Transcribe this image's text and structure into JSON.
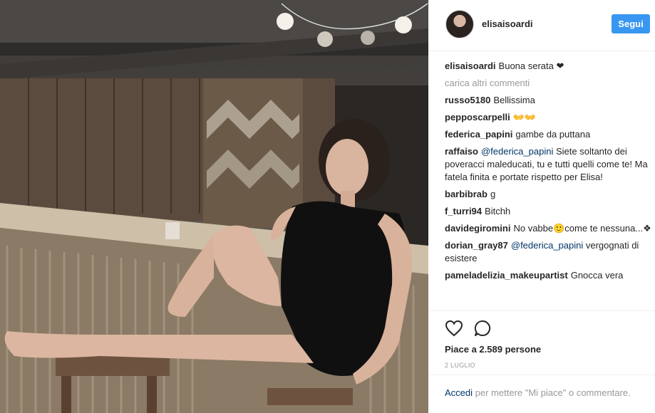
{
  "post": {
    "username": "elisaisoardi",
    "follow_label": "Segui",
    "caption_user": "elisaisoardi",
    "caption_text": "Buona serata ❤",
    "load_more": "carica altri commenti",
    "comments": [
      {
        "user": "russo5180",
        "text": "Bellissima",
        "mention": ""
      },
      {
        "user": "pepposcarpelli",
        "text": "👐👐",
        "mention": ""
      },
      {
        "user": "federica_papini",
        "text": "gambe da puttana",
        "mention": ""
      },
      {
        "user": "raffaiso",
        "mention": "@federica_papini",
        "text": "Siete soltanto dei poveracci maleducati, tu e tutti quelli come te! Ma fatela finita e portate rispetto per Elisa!"
      },
      {
        "user": "barbibrab",
        "text": "g",
        "mention": ""
      },
      {
        "user": "f_turri94",
        "text": "Bitchh",
        "mention": ""
      },
      {
        "user": "davidegiromini",
        "text": "No vabbe🙂come te nessuna...❖",
        "mention": ""
      },
      {
        "user": "dorian_gray87",
        "mention": "@federica_papini",
        "text": "vergognati di esistere"
      },
      {
        "user": "pameladelizia_makeupartist",
        "text": "Gnocca vera",
        "mention": ""
      }
    ],
    "likes_text": "Piace a 2.589 persone",
    "date": "2 LUGLIO",
    "login_link": "Accedi",
    "login_rest": "per mettere \"Mi piace\" o commentare."
  },
  "icons": {
    "like": "heart-icon",
    "comment": "comment-icon",
    "avatar": "avatar"
  },
  "colors": {
    "accent": "#3897f0",
    "link": "#003569",
    "muted": "#999999",
    "text": "#262626"
  }
}
